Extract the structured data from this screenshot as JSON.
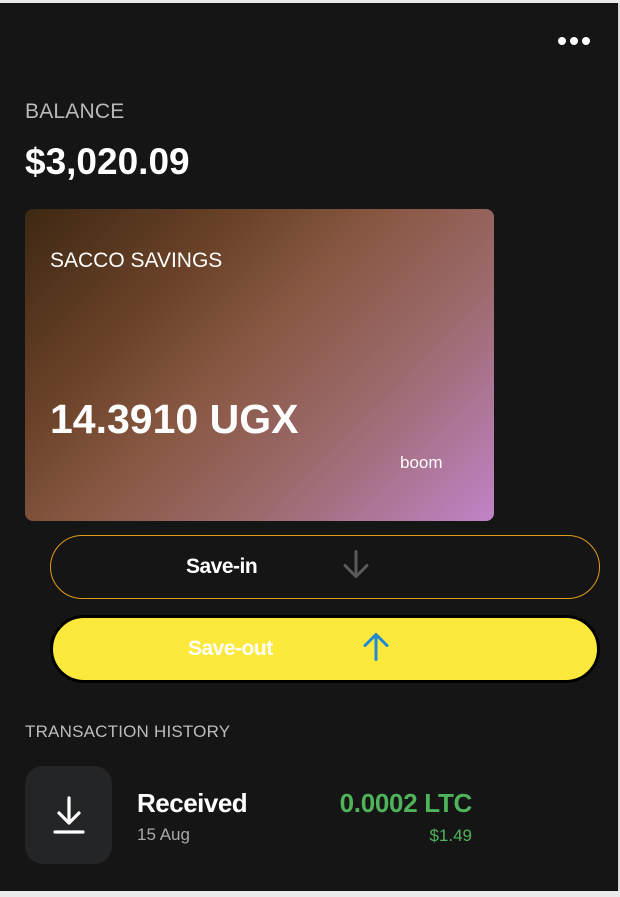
{
  "header": {
    "menu_icon": "more-horizontal-icon"
  },
  "balance": {
    "label": "BALANCE",
    "value": "$3,020.09"
  },
  "card": {
    "title": "SACCO SAVINGS",
    "amount": "14.3910 UGX",
    "owner": "boom",
    "gradient_start": "#3e2813",
    "gradient_end": "#c083c8"
  },
  "actions": {
    "save_in": {
      "label": "Save-in",
      "icon": "arrow-down-icon",
      "border_color": "#e09a1c"
    },
    "save_out": {
      "label": "Save-out",
      "icon": "arrow-up-icon",
      "background": "#fde83c"
    }
  },
  "history": {
    "title": "TRANSACTION HISTORY",
    "items": [
      {
        "type": "Received",
        "date": "15 Aug",
        "amount": "0.0002 LTC",
        "fiat": "$1.49",
        "icon": "download-icon",
        "amount_color": "#4fb35a"
      }
    ]
  }
}
